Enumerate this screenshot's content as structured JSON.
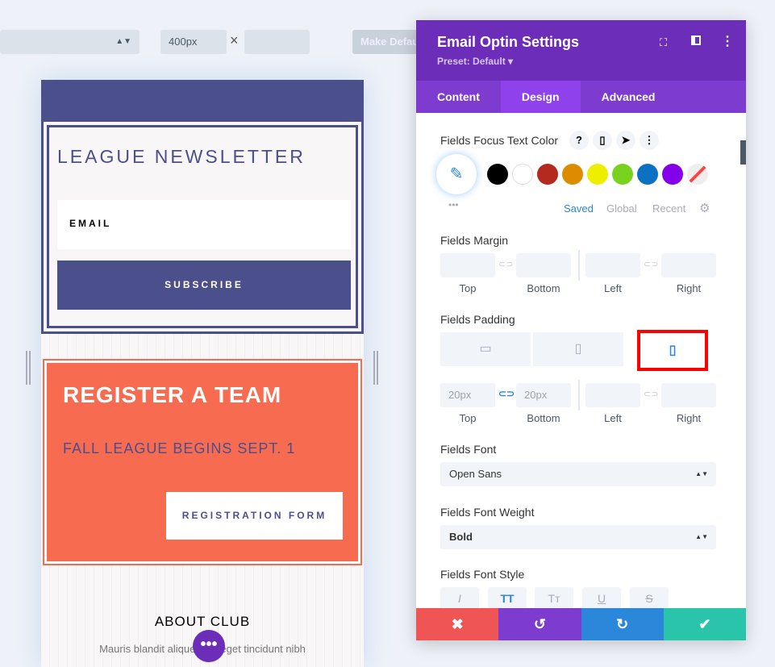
{
  "toolbar": {
    "width_value": "400px",
    "times": "×",
    "make_default": "Make Default"
  },
  "preview": {
    "newsletter_title": "LEAGUE NEWSLETTER",
    "email_placeholder": "EMAIL",
    "subscribe": "SUBSCRIBE",
    "register_title": "REGISTER A TEAM",
    "register_sub": "FALL LEAGUE BEGINS SEPT. 1",
    "register_button": "REGISTRATION FORM",
    "about_title": "ABOUT CLUB",
    "about_text": "Mauris blandit aliquet elit, eget tincidunt nibh"
  },
  "panel": {
    "title": "Email Optin Settings",
    "preset": "Preset: Default ▾",
    "tabs": [
      {
        "label": "Content"
      },
      {
        "label": "Design",
        "active": true
      },
      {
        "label": "Advanced"
      }
    ],
    "focus_color": {
      "label": "Fields Focus Text Color",
      "help": "?",
      "swatches": [
        "#000000",
        "#ffffff",
        "#b52a1e",
        "#dd8c00",
        "#eeee00",
        "#7ad21e",
        "#0c71c3",
        "#8300e9"
      ],
      "tabs": [
        "Saved",
        "Global",
        "Recent"
      ],
      "active_tab": "Saved"
    },
    "margin": {
      "label": "Fields Margin",
      "sides": [
        "Top",
        "Bottom",
        "Left",
        "Right"
      ],
      "values": [
        "",
        "",
        "",
        ""
      ]
    },
    "padding": {
      "label": "Fields Padding",
      "device": "phone",
      "sides": [
        "Top",
        "Bottom",
        "Left",
        "Right"
      ],
      "placeholders": [
        "20px",
        "20px",
        "",
        ""
      ]
    },
    "font": {
      "label": "Fields Font",
      "value": "Open Sans"
    },
    "weight": {
      "label": "Fields Font Weight",
      "value": "Bold"
    },
    "style": {
      "label": "Fields Font Style",
      "options": [
        "I",
        "TT",
        "Tт",
        "U",
        "S"
      ]
    },
    "footer": {
      "cancel": "✖",
      "undo": "↺",
      "redo": "↻",
      "save": "✔"
    }
  },
  "colors": {
    "purple": "#6c2eb9",
    "navy": "#4b4f8c",
    "coral": "#f76b50",
    "highlight": "#ff0000"
  }
}
